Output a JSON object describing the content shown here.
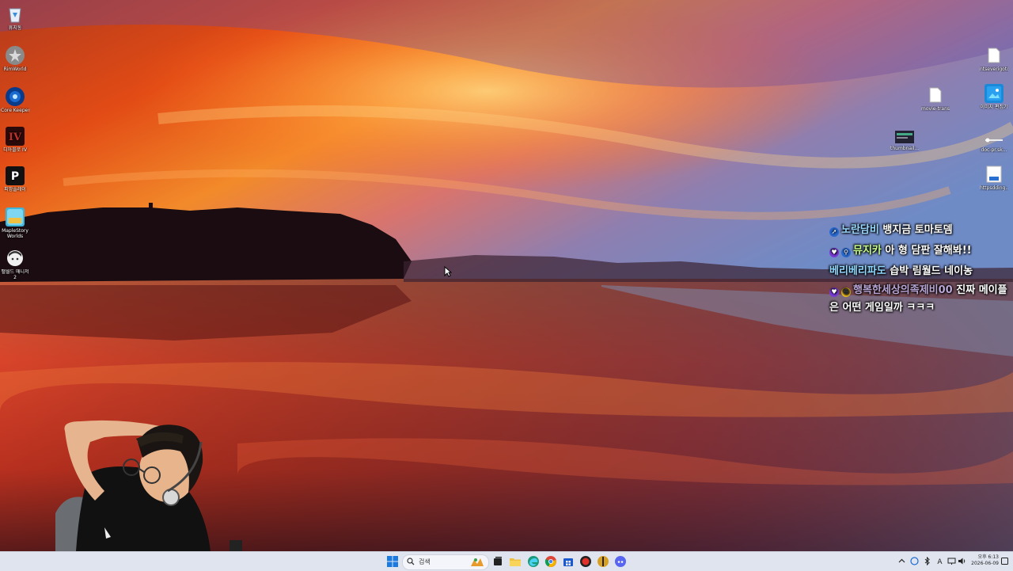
{
  "desktop_icons_left": [
    {
      "label": "휴지통",
      "icon": "recycle-bin-icon"
    },
    {
      "label": "RimWorld",
      "icon": "rimworld-icon"
    },
    {
      "label": "Core Keeper",
      "icon": "core-keeper-icon"
    },
    {
      "label": "디아블로 IV",
      "icon": "diablo-iv-icon"
    },
    {
      "label": "피망플레이",
      "icon": "pmang-icon"
    },
    {
      "label": "MapleStory Worlds",
      "icon": "maplestory-worlds-icon"
    },
    {
      "label": "팰월드 매니저 2",
      "icon": "anime-app-icon"
    }
  ],
  "desktop_icons_right": [
    {
      "label": "ntseverigoto...",
      "icon": "file-icon"
    },
    {
      "label": "movie-trans...",
      "icon": "file-icon"
    },
    {
      "label": "이미지 편집기",
      "icon": "image-file-icon"
    },
    {
      "label": "thumbnail...",
      "icon": "thumbnail-icon"
    },
    {
      "label": "doc-pr.sk...",
      "icon": "shortcut-icon"
    },
    {
      "label": "httpsdding...",
      "icon": "document-icon"
    }
  ],
  "chat": [
    {
      "badge": "rocket",
      "user": "노란담비",
      "user_color": "#9ad9ff",
      "message": "뱅지금 토마토뎀"
    },
    {
      "badge": "heart",
      "user": "뮤지카",
      "user_color": "#c7ff8a",
      "message": "아 형 담판 잘해봐!!"
    },
    {
      "badge": "",
      "user": "베리베리파도",
      "user_color": "#8fd8ff",
      "message": "습박 림월드 네이농"
    },
    {
      "badge": "heart",
      "user": "행복한세상의족제비00",
      "user_color": "#b9a6d6",
      "message": "진짜 메이플은 어떤 게임일까 ㅋㅋㅋ"
    }
  ],
  "taskbar": {
    "search_placeholder": "검색",
    "apps": [
      "start",
      "search",
      "widgets",
      "task-view",
      "file-explorer",
      "edge",
      "chrome",
      "microsoft-store",
      "app-red",
      "app-yellow",
      "discord"
    ]
  },
  "clock": {
    "time": "오후 6:13",
    "date": "2026-06-09"
  },
  "colors": {
    "taskbar_bg": "#dfe4ef",
    "accent": "#0067c0"
  }
}
